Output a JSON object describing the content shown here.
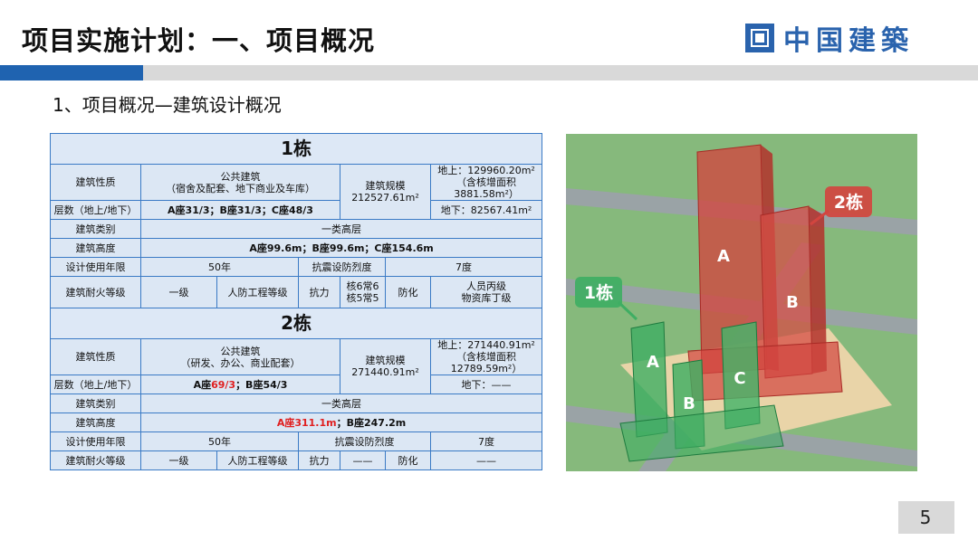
{
  "header": {
    "title": "项目实施计划：一、项目概况",
    "logo_text": "中国建築"
  },
  "subtitle": "1、项目概况—建筑设计概况",
  "building1": {
    "title": "1栋",
    "nature_label": "建筑性质",
    "nature_line1": "公共建筑",
    "nature_line2": "（宿舍及配套、地下商业及车库）",
    "scale_label_line1": "建筑规模",
    "scale_label_line2": "212527.61m²",
    "above_line1": "地上：129960.20m²",
    "above_line2": "（含核增面积3881.58m²）",
    "floors_label": "层数（地上/地下）",
    "floors_value": "A座31/3；B座31/3；C座48/3",
    "below": "地下：82567.41m²",
    "category_label": "建筑类别",
    "category_value": "一类高层",
    "height_label": "建筑高度",
    "height_value": "A座99.6m；B座99.6m；C座154.6m",
    "life_label": "设计使用年限",
    "life_value": "50年",
    "seismic_label": "抗震设防烈度",
    "seismic_value": "7度",
    "fire_label": "建筑耐火等级",
    "fire_value": "一级",
    "civil_label": "人防工程等级",
    "resist_label": "抗力",
    "resist_line1": "核6常6",
    "resist_line2": "核5常5",
    "protect_label": "防化",
    "protect_line1": "人员丙级",
    "protect_line2": "物资库丁级"
  },
  "building2": {
    "title": "2栋",
    "nature_label": "建筑性质",
    "nature_line1": "公共建筑",
    "nature_line2": "（研发、办公、商业配套）",
    "scale_label_line1": "建筑规模",
    "scale_label_line2": "271440.91m²",
    "above_line1": "地上：271440.91m²",
    "above_line2": "（含核增面积12789.59m²）",
    "floors_label": "层数（地上/地下）",
    "floors_a_prefix": "A座",
    "floors_a_value": "69/3",
    "floors_b": "；B座54/3",
    "below": "地下：——",
    "category_label": "建筑类别",
    "category_value": "一类高层",
    "height_label": "建筑高度",
    "height_a": "A座311.1m",
    "height_b": "；B座247.2m",
    "life_label": "设计使用年限",
    "life_value": "50年",
    "seismic_label": "抗震设防烈度",
    "seismic_value": "7度",
    "fire_label": "建筑耐火等级",
    "fire_value": "一级",
    "civil_label": "人防工程等级",
    "resist_label": "抗力",
    "resist_value": "——",
    "protect_label": "防化",
    "protect_value": "——"
  },
  "photo_labels": {
    "building2_tag": "2栋",
    "building1_tag": "1栋",
    "tower2_a": "A",
    "tower2_b": "B",
    "tower1_a": "A",
    "tower1_b": "B",
    "tower1_c": "C"
  },
  "colors": {
    "brand_blue": "#1f63b0",
    "table_border": "#3a7ac5",
    "table_fill": "#dce7f4",
    "highlight_red": "#e02020",
    "building2_red": "#d2453f",
    "building1_green": "#3fae63"
  },
  "page_number": "5"
}
